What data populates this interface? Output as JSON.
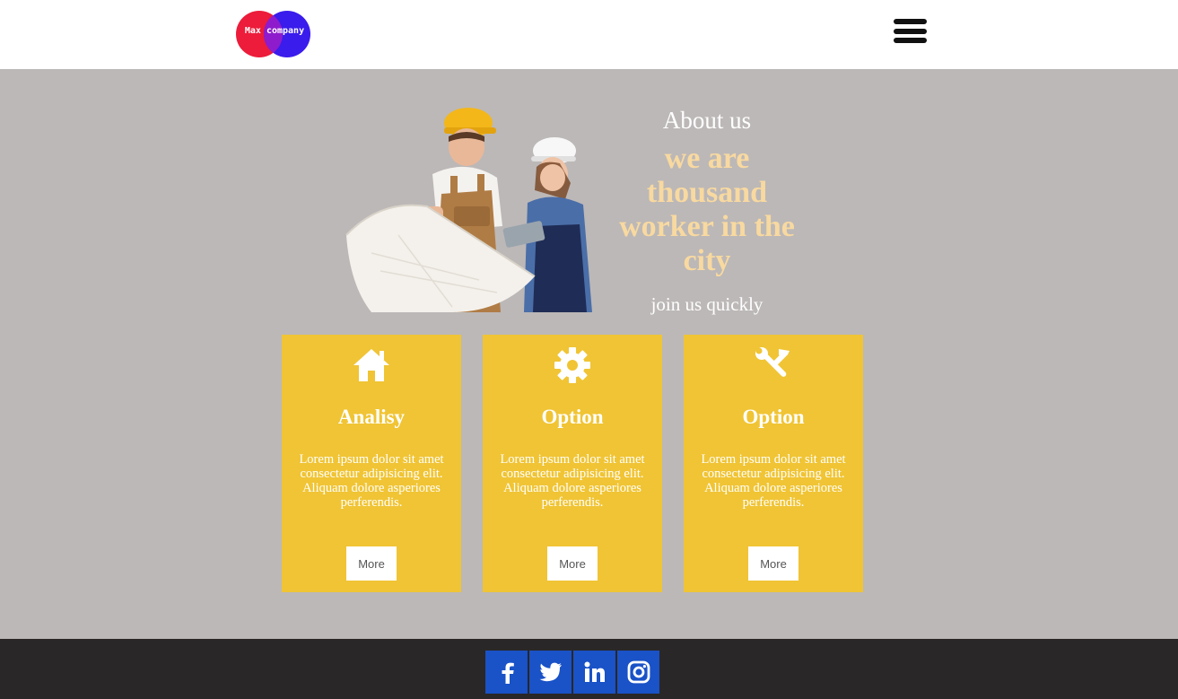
{
  "header": {
    "logo_text": "Max company",
    "menu_icon": "hamburger-menu-icon"
  },
  "hero": {
    "image": "construction-workers-image",
    "about_title": "About us",
    "tagline": "we are thousand worker in the city",
    "subtitle": "join us quickly"
  },
  "cards": [
    {
      "icon": "home-icon",
      "title": "Analisy",
      "body": "Lorem ipsum dolor sit amet consectetur adipisicing elit. Aliquam dolore asperiores perferendis.",
      "button": "More"
    },
    {
      "icon": "gear-icon",
      "title": "Option",
      "body": "Lorem ipsum dolor sit amet consectetur adipisicing elit. Aliquam dolore asperiores perferendis.",
      "button": "More"
    },
    {
      "icon": "tools-icon",
      "title": "Option",
      "body": "Lorem ipsum dolor sit amet consectetur adipisicing elit. Aliquam dolore asperiores perferendis.",
      "button": "More"
    }
  ],
  "footer": {
    "social": [
      {
        "icon": "facebook-icon"
      },
      {
        "icon": "twitter-icon"
      },
      {
        "icon": "linkedin-icon"
      },
      {
        "icon": "instagram-icon"
      }
    ]
  },
  "colors": {
    "page_background": "#bcb8b7",
    "card_yellow": "#f0c434",
    "tagline_peach": "#f8d9a0",
    "footer_dark": "#292727",
    "social_blue": "#1a52c7",
    "logo_red": "#ec1c3a",
    "logo_blue": "#3a1cec"
  }
}
